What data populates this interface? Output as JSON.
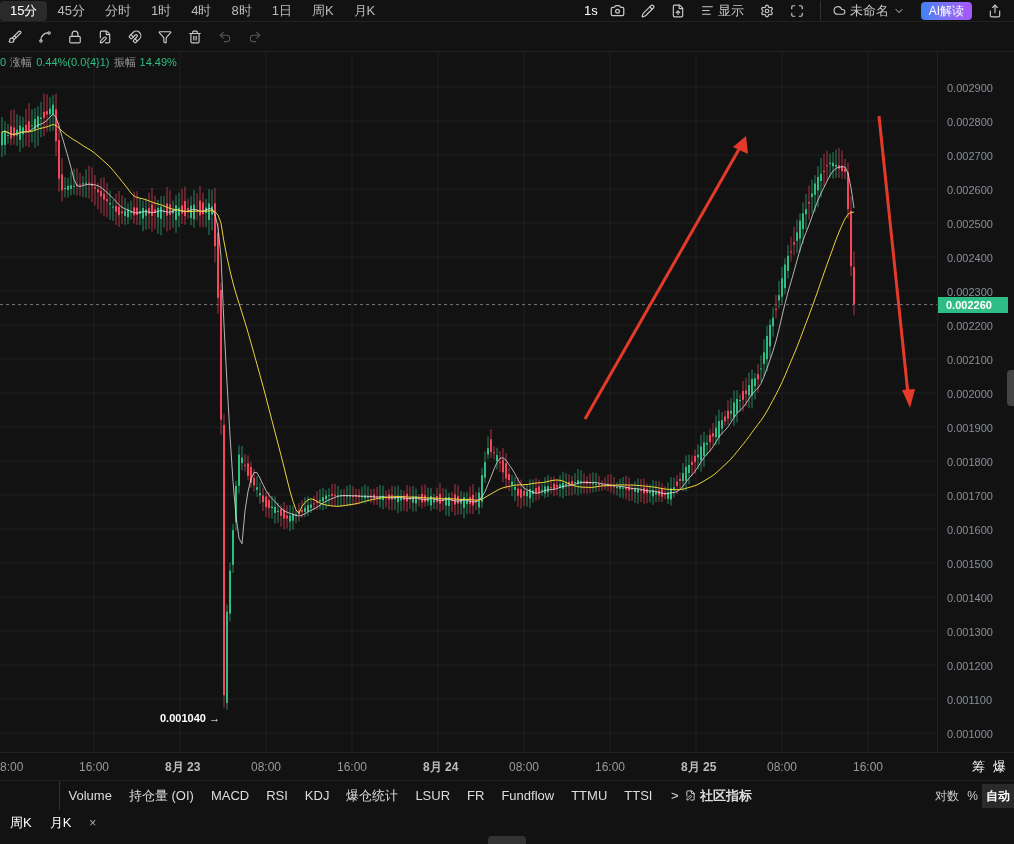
{
  "timeframes": [
    {
      "label": "15分",
      "selected": true
    },
    {
      "label": "45分",
      "selected": false
    },
    {
      "label": "分时",
      "selected": false
    },
    {
      "label": "1时",
      "selected": false
    },
    {
      "label": "4时",
      "selected": false
    },
    {
      "label": "8时",
      "selected": false
    },
    {
      "label": "1日",
      "selected": false
    },
    {
      "label": "周K",
      "selected": false
    },
    {
      "label": "月K",
      "selected": false
    }
  ],
  "top_right": {
    "interval": "1s",
    "display": "显示",
    "layout_name": "未命名",
    "ai_button": "AI解读"
  },
  "info_line": [
    {
      "kind": "value",
      "text": "0"
    },
    {
      "kind": "label",
      "text": "涨幅"
    },
    {
      "kind": "value",
      "text": "0.44%(0.0{4}1)"
    },
    {
      "kind": "label",
      "text": "振幅"
    },
    {
      "kind": "value",
      "text": "14.49%"
    }
  ],
  "price_axis": [
    "0.002900",
    "0.002800",
    "0.002700",
    "0.002600",
    "0.002500",
    "0.002400",
    "0.002300",
    "0.002200",
    "0.002100",
    "0.002000",
    "0.001900",
    "0.001800",
    "0.001700",
    "0.001600",
    "0.001500",
    "0.001400",
    "0.001300",
    "0.001200",
    "0.001100",
    "0.001000"
  ],
  "current_price": "0.002260",
  "low_marker": "0.001040 →",
  "time_axis": [
    {
      "text": "8:00",
      "bold": false
    },
    {
      "text": "16:00",
      "bold": false
    },
    {
      "text": "8月 23",
      "bold": true
    },
    {
      "text": "08:00",
      "bold": false
    },
    {
      "text": "16:00",
      "bold": false
    },
    {
      "text": "8月 24",
      "bold": true
    },
    {
      "text": "08:00",
      "bold": false
    },
    {
      "text": "16:00",
      "bold": false
    },
    {
      "text": "8月 25",
      "bold": true
    },
    {
      "text": "08:00",
      "bold": false
    },
    {
      "text": "16:00",
      "bold": false
    }
  ],
  "axis_corner": [
    "筹",
    "爆"
  ],
  "indicators": [
    "Volume",
    "持仓量 (OI)",
    "MACD",
    "RSI",
    "KDJ",
    "爆仓统计",
    "LSUR",
    "FR",
    "Fundflow",
    "TTMU",
    "TTSI"
  ],
  "more": ">",
  "community": "社区指标",
  "scale_options": [
    {
      "label": "对数",
      "selected": false
    },
    {
      "label": "%",
      "selected": false
    },
    {
      "label": "自动",
      "selected": true
    }
  ],
  "bottom_tabs": [
    "周K",
    "月K"
  ],
  "bottom_close": "×"
}
